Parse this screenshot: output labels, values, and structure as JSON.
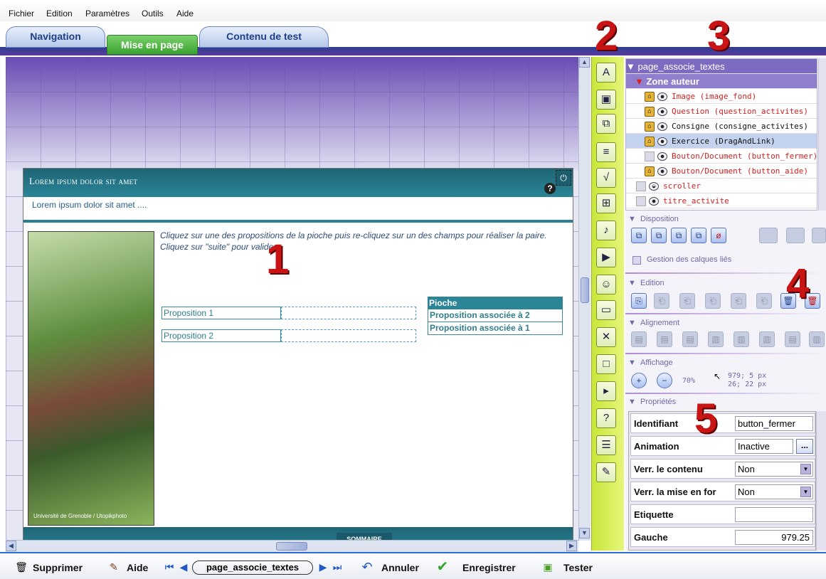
{
  "menu": [
    "Fichier",
    "Edition",
    "Paramètres",
    "Outils",
    "Aide"
  ],
  "tabs": {
    "navigation": "Navigation",
    "mise_en_page": "Mise en page",
    "contenu": "Contenu de test"
  },
  "canvas": {
    "page_title": "Lorem ipsum dolor sit amet",
    "page_subtitle": "Lorem ipsum dolor sit amet ....",
    "instructions": "Cliquez sur une des propositions de la pioche puis re-cliquez sur un des champs pour réaliser la paire. Cliquez sur \"suite\" pour valider.",
    "propositions": [
      "Proposition 1",
      "Proposition 2"
    ],
    "pioche_header": "Pioche",
    "pioche_items": [
      "Proposition associée à 2",
      "Proposition associée à 1"
    ],
    "photo_credit": "Université de Grenoble / Utopikphoto",
    "footer_button": "SOMMAIRE",
    "help_glyph": "?",
    "power_glyph": "⏻"
  },
  "callouts": [
    "1",
    "2",
    "3",
    "4",
    "5"
  ],
  "tree": {
    "root": "page_associe_textes",
    "zone": "Zone auteur",
    "items": [
      {
        "label": "Image (image_fond)",
        "color": "#d42020"
      },
      {
        "label": "Question (question_activites)",
        "color": "#d42020"
      },
      {
        "label": "Consigne (consigne_activites)",
        "color": "#111111"
      },
      {
        "label": "Exercice (DragAndLink)",
        "color": "#111111"
      },
      {
        "label": "Bouton/Document (button_fermer)",
        "color": "#d42020"
      },
      {
        "label": "Bouton/Document (button_aide)",
        "color": "#d42020"
      }
    ],
    "extras": [
      {
        "label": "scroller",
        "color": "#d42020"
      },
      {
        "label": "titre_activite",
        "color": "#d42020"
      }
    ]
  },
  "sections": {
    "disposition": "Disposition",
    "calques": "Gestion des calques liés",
    "edition": "Edition",
    "alignement": "Alignement",
    "affichage": "Affichage",
    "proprietes": "Propriétés"
  },
  "affichage": {
    "zoom": "70%",
    "pos": "979; 5 px",
    "size": "26; 22 px"
  },
  "properties": [
    {
      "label": "Identifiant",
      "value": "button_fermer"
    },
    {
      "label": "Animation",
      "value": "Inactive"
    },
    {
      "label": "Verr. le contenu",
      "value": "Non"
    },
    {
      "label": "Verr. la mise en for",
      "value": "Non"
    },
    {
      "label": "Etiquette",
      "value": ""
    },
    {
      "label": "Gauche",
      "value": "979.25"
    }
  ],
  "bottombar": {
    "supprimer": "Supprimer",
    "aide": "Aide",
    "page": "page_associe_textes",
    "annuler": "Annuler",
    "enregistrer": "Enregistrer",
    "tester": "Tester"
  },
  "colors": {
    "accent_green": "#3aa22f",
    "teal": "#2b8597",
    "purple": "#5a3aa0",
    "callout_red": "#c81414"
  }
}
